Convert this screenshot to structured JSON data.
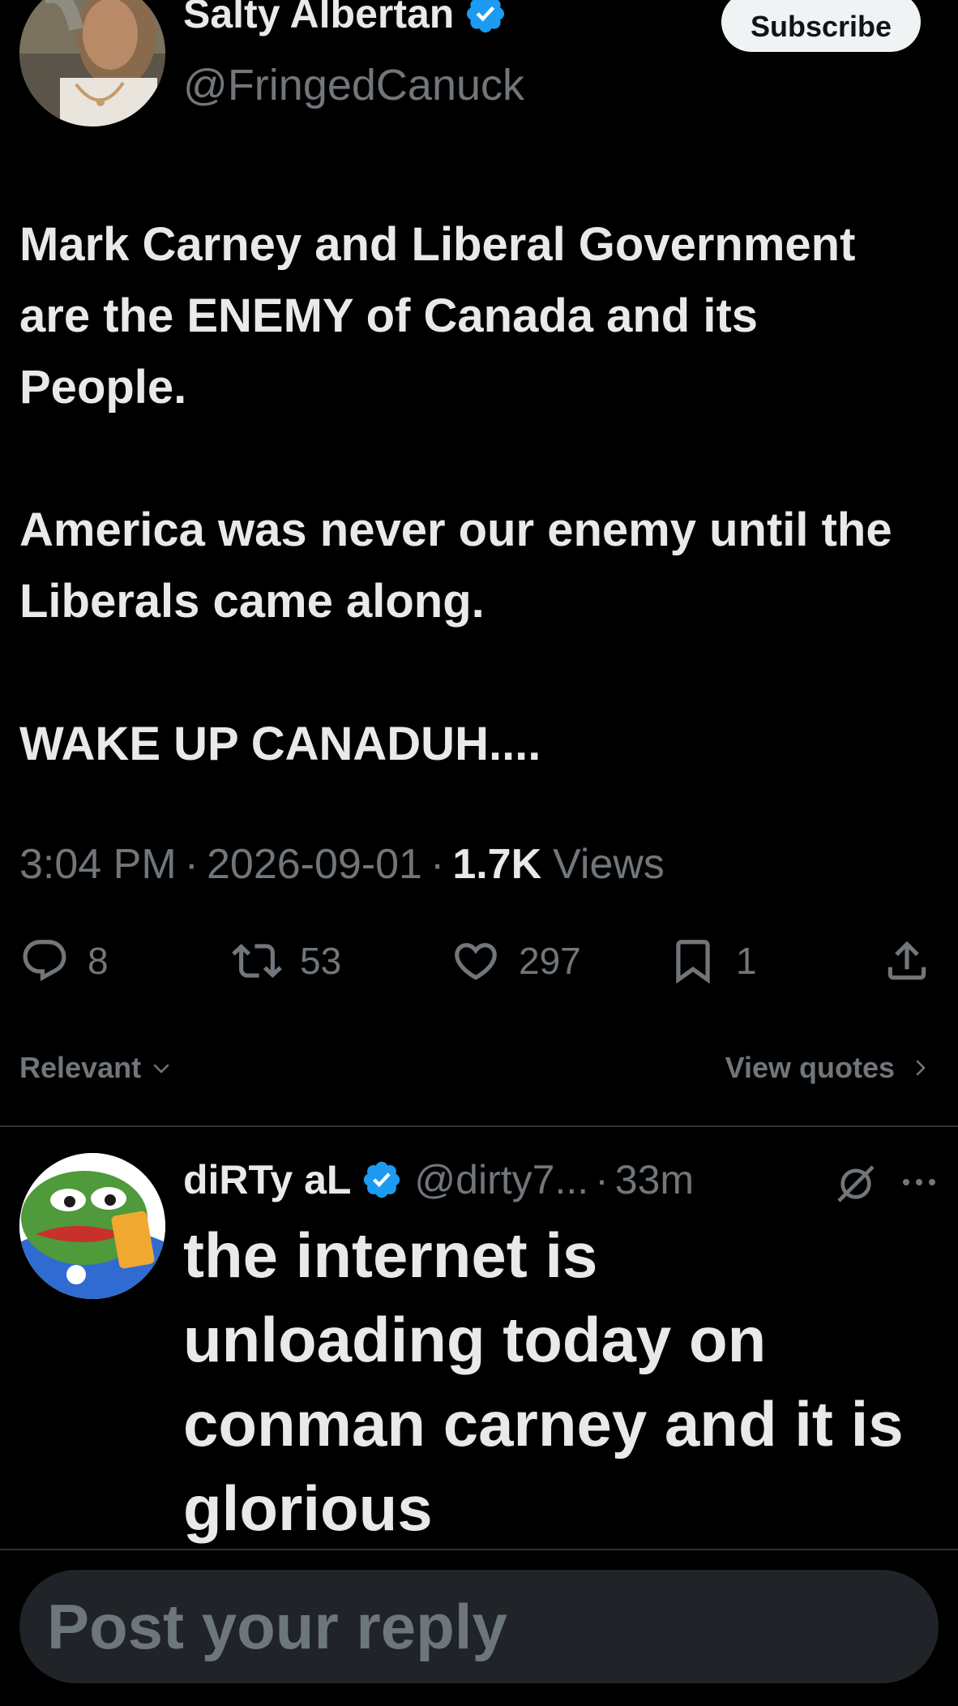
{
  "colors": {
    "background": "#000000",
    "text_primary": "#e7e9ea",
    "text_secondary": "#71767b",
    "verified_blue": "#1d9bf0",
    "divider": "#2f3336",
    "composer_bg": "#202327"
  },
  "header": {
    "author_name": "Salty Albertan",
    "author_handle": "@FringedCanuck",
    "subscribe_label": "Subscribe",
    "verified_icon": "verified-badge-icon"
  },
  "tweet": {
    "paragraphs": [
      "Mark Carney and Liberal Government are the ENEMY of Canada and its People.",
      "America was never our enemy until the Liberals came along.",
      "WAKE UP CANADUH...."
    ],
    "time": "3:04 PM",
    "date": "2026-09-01",
    "views_count": "1.7K",
    "views_label": "Views",
    "separator": "·"
  },
  "actions": {
    "reply_count": "8",
    "repost_count": "53",
    "like_count": "297",
    "bookmark_count": "1",
    "icons": [
      "reply-icon",
      "repost-icon",
      "like-icon",
      "bookmark-icon",
      "share-icon"
    ]
  },
  "sort": {
    "relevant_label": "Relevant",
    "view_quotes_label": "View quotes"
  },
  "reply": {
    "name": "diRTy aL",
    "handle": "@dirty7...",
    "separator": "·",
    "time": "33m",
    "text": "the internet is unloading today on conman carney and it is glorious",
    "icons": [
      "grok-icon",
      "more-icon"
    ]
  },
  "composer": {
    "placeholder": "Post your reply"
  }
}
